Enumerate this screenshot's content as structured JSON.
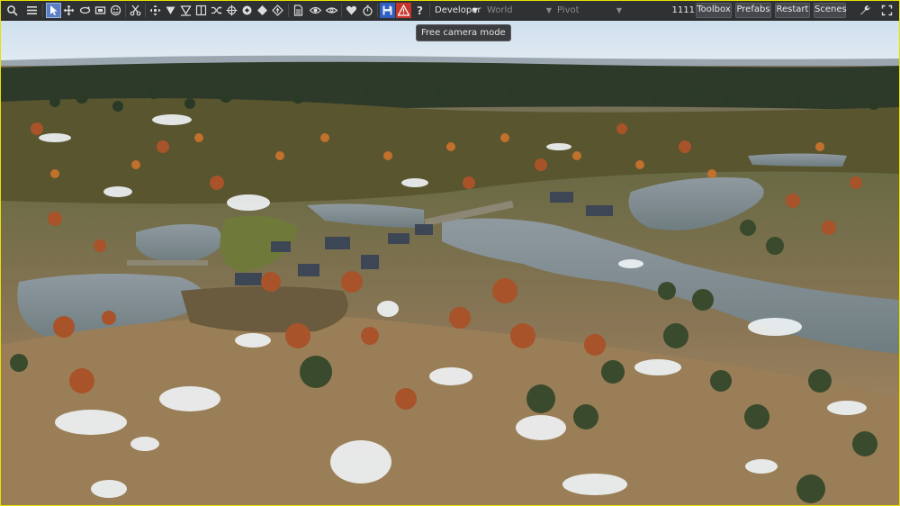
{
  "toolbar": {
    "dropdowns": {
      "profile": "Developer",
      "space": "World",
      "pivot": "Pivot"
    },
    "counter": "1111",
    "buttons": {
      "toolbox": "Toolbox",
      "prefabs": "Prefabs",
      "restart": "Restart",
      "scenes": "Scenes"
    }
  },
  "tooltip": "Free camera mode",
  "colors": {
    "toolbar_bg": "#2f3133",
    "frame_border": "#e8e100",
    "active_tool": "#5b7fc4",
    "warning_button": "#c8352b",
    "save_button": "#2f5fc0"
  },
  "viewport": {
    "scene": "aerial-autumn-landscape-with-lakes-village-and-forest"
  }
}
